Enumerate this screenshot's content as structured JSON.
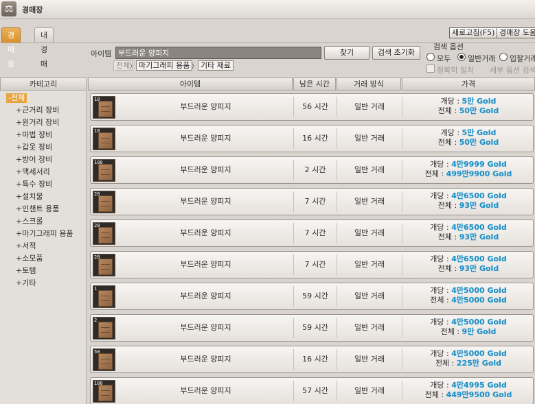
{
  "window": {
    "title": "경매장",
    "icon": "balance-scale-icon"
  },
  "tabs": [
    {
      "label": "경매장",
      "active": true
    },
    {
      "label": "내 경매",
      "active": false
    }
  ],
  "top_buttons": {
    "refresh": "새로고침(F5)",
    "help": "경매장 도움"
  },
  "search": {
    "item_label": "아이템",
    "query": "부드러운 양피지",
    "find_button": "찾기",
    "reset_button": "검색 초기화",
    "breadcrumbs": [
      "전체",
      "마기그래피 용품",
      "기타 재료"
    ],
    "separator": "〉",
    "options_title": "검색 옵션",
    "radios": [
      {
        "label": "모두",
        "checked": false
      },
      {
        "label": "일반거래",
        "checked": true
      },
      {
        "label": "입찰거래",
        "checked": false
      }
    ],
    "exact_match": "정확히 일치",
    "detail_options": "세부 옵션 검색"
  },
  "columns": {
    "category": "카테고리",
    "item": "아이템",
    "time": "남은 시간",
    "method": "거래 방식",
    "price": "가격"
  },
  "categories": [
    {
      "label": "-전체",
      "selected": true
    },
    {
      "label": "+근거리 장비"
    },
    {
      "label": "+원거리 장비"
    },
    {
      "label": "+마법 장비"
    },
    {
      "label": "+갑옷 장비"
    },
    {
      "label": "+방어 장비"
    },
    {
      "label": "+액세서리"
    },
    {
      "label": "+특수 장비"
    },
    {
      "label": "+설치물"
    },
    {
      "label": "+인챈트 용품"
    },
    {
      "label": "+스크롤"
    },
    {
      "label": "+마기그래피 용품"
    },
    {
      "label": "+서적"
    },
    {
      "label": "+소모품"
    },
    {
      "label": "+토템"
    },
    {
      "label": "+기타"
    }
  ],
  "price_labels": {
    "unit": "개당 : ",
    "total": "전체 : "
  },
  "listings": [
    {
      "stack": "10",
      "name": "부드러운 양피지",
      "time": "56 시간",
      "method": "일반 거래",
      "unit_price": "5만 Gold",
      "total_price": "50만 Gold"
    },
    {
      "stack": "10",
      "name": "부드러운 양피지",
      "time": "16 시간",
      "method": "일반 거래",
      "unit_price": "5만 Gold",
      "total_price": "50만 Gold"
    },
    {
      "stack": "100",
      "name": "부드러운 양피지",
      "time": "2 시간",
      "method": "일반 거래",
      "unit_price": "4만9999 Gold",
      "total_price": "499만9900 Gold"
    },
    {
      "stack": "20",
      "name": "부드러운 양피지",
      "time": "7 시간",
      "method": "일반 거래",
      "unit_price": "4만6500 Gold",
      "total_price": "93만 Gold"
    },
    {
      "stack": "20",
      "name": "부드러운 양피지",
      "time": "7 시간",
      "method": "일반 거래",
      "unit_price": "4만6500 Gold",
      "total_price": "93만 Gold"
    },
    {
      "stack": "20",
      "name": "부드러운 양피지",
      "time": "7 시간",
      "method": "일반 거래",
      "unit_price": "4만6500 Gold",
      "total_price": "93만 Gold"
    },
    {
      "stack": "1",
      "name": "부드러운 양피지",
      "time": "59 시간",
      "method": "일반 거래",
      "unit_price": "4만5000 Gold",
      "total_price": "4만5000 Gold"
    },
    {
      "stack": "2",
      "name": "부드러운 양피지",
      "time": "59 시간",
      "method": "일반 거래",
      "unit_price": "4만5000 Gold",
      "total_price": "9만 Gold"
    },
    {
      "stack": "50",
      "name": "부드러운 양피지",
      "time": "16 시간",
      "method": "일반 거래",
      "unit_price": "4만5000 Gold",
      "total_price": "225만 Gold"
    },
    {
      "stack": "100",
      "name": "부드러운 양피지",
      "time": "57 시간",
      "method": "일반 거래",
      "unit_price": "4만4995 Gold",
      "total_price": "449만9500 Gold"
    }
  ]
}
